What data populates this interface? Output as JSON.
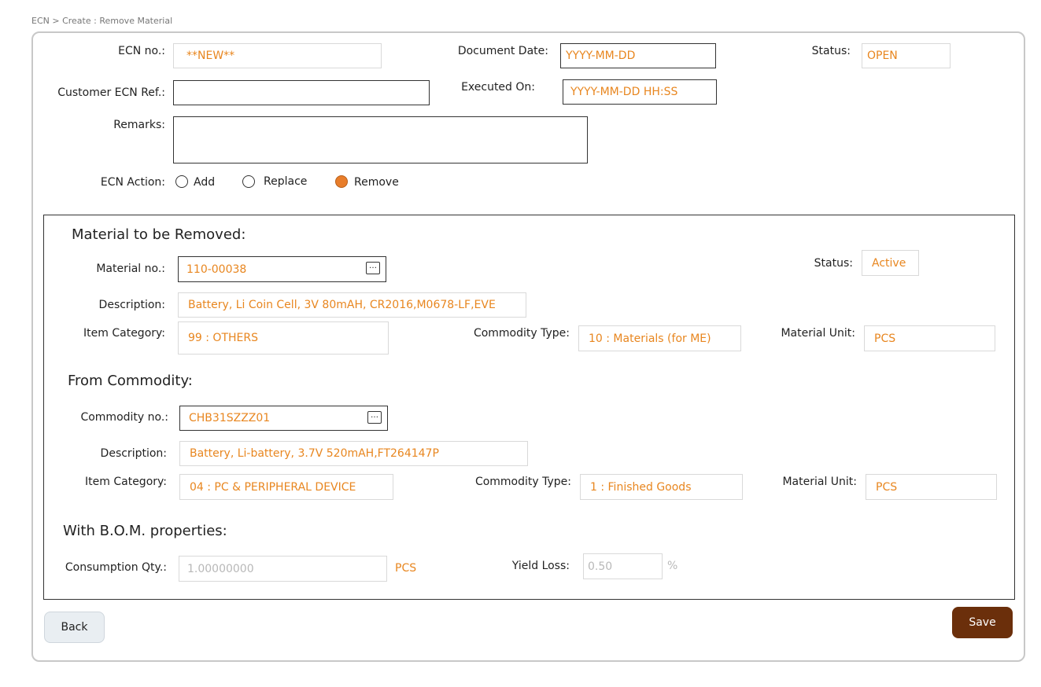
{
  "breadcrumb": "ECN > Create : Remove Material",
  "header": {
    "ecn_no": {
      "label": "ECN no.:",
      "value": "**NEW**"
    },
    "document_date": {
      "label": "Document Date:",
      "value": "YYYY-MM-DD"
    },
    "status": {
      "label": "Status:",
      "value": "OPEN"
    },
    "customer_ecn_ref": {
      "label": "Customer ECN Ref.:",
      "value": ""
    },
    "executed_on": {
      "label": "Executed On:",
      "value": "YYYY-MM-DD HH:SS"
    },
    "remarks": {
      "label": "Remarks:",
      "value": ""
    },
    "ecn_action": {
      "label": "ECN Action:",
      "options": [
        "Add",
        "Replace",
        "Remove"
      ],
      "selected": "Remove"
    }
  },
  "material": {
    "title": "Material to be Removed:",
    "material_no": {
      "label": "Material no.:",
      "value": "110-00038"
    },
    "status": {
      "label": "Status:",
      "value": "Active"
    },
    "description": {
      "label": "Description:",
      "value": "Battery, Li Coin Cell, 3V 80mAH, CR2016,M0678-LF,EVE"
    },
    "item_category": {
      "label": "Item Category:",
      "value": "99 : OTHERS"
    },
    "commodity_type": {
      "label": "Commodity Type:",
      "value": "10 : Materials (for ME)"
    },
    "material_unit": {
      "label": "Material Unit:",
      "value": "PCS"
    }
  },
  "commodity": {
    "title": "From Commodity:",
    "commodity_no": {
      "label": "Commodity no.:",
      "value": "CHB31SZZZ01"
    },
    "description": {
      "label": "Description:",
      "value": "Battery, Li-battery, 3.7V 520mAH,FT264147P"
    },
    "item_category": {
      "label": "Item Category:",
      "value": "04 : PC & PERIPHERAL DEVICE"
    },
    "commodity_type": {
      "label": "Commodity Type:",
      "value": "1 : Finished Goods"
    },
    "material_unit": {
      "label": "Material Unit:",
      "value": "PCS"
    }
  },
  "bom": {
    "title": "With B.O.M. properties:",
    "consumption_qty": {
      "label": "Consumption Qty.:",
      "value": "1.00000000",
      "unit": "PCS"
    },
    "yield_loss": {
      "label": "Yield Loss:",
      "value": "0.50",
      "unit": "%"
    }
  },
  "buttons": {
    "back": "Back",
    "save": "Save"
  },
  "colors": {
    "accent": "#e8861f",
    "save_button": "#6b2f0b",
    "radio_selected": "#e87d2a"
  },
  "icons": {
    "browse": "ellipsis-icon"
  }
}
